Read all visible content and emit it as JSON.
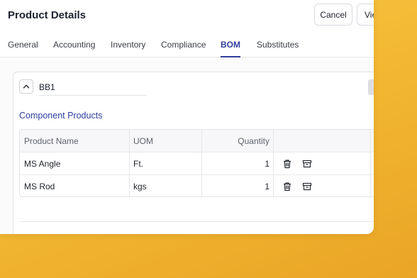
{
  "header": {
    "title": "Product Details",
    "cancel_label": "Cancel",
    "view_label": "Vie"
  },
  "tabs": [
    {
      "label": "General",
      "active": false
    },
    {
      "label": "Accounting",
      "active": false
    },
    {
      "label": "Inventory",
      "active": false
    },
    {
      "label": "Compliance",
      "active": false
    },
    {
      "label": "BOM",
      "active": true
    },
    {
      "label": "Substitutes",
      "active": false
    }
  ],
  "bom": {
    "group_name": "BB1",
    "section_title": "Component Products",
    "columns": [
      "Product Name",
      "UOM",
      "Quantity",
      ""
    ],
    "rows": [
      {
        "name": "MS Angle",
        "uom": "Ft.",
        "quantity": "1"
      },
      {
        "name": "MS Rod",
        "uom": "kgs",
        "quantity": "1"
      }
    ]
  },
  "icons": {
    "collapse": "chevron-up-icon",
    "delete": "trash-icon",
    "archive": "archive-icon"
  },
  "colors": {
    "accent": "#2f3e9e",
    "background": "#f3b933"
  }
}
